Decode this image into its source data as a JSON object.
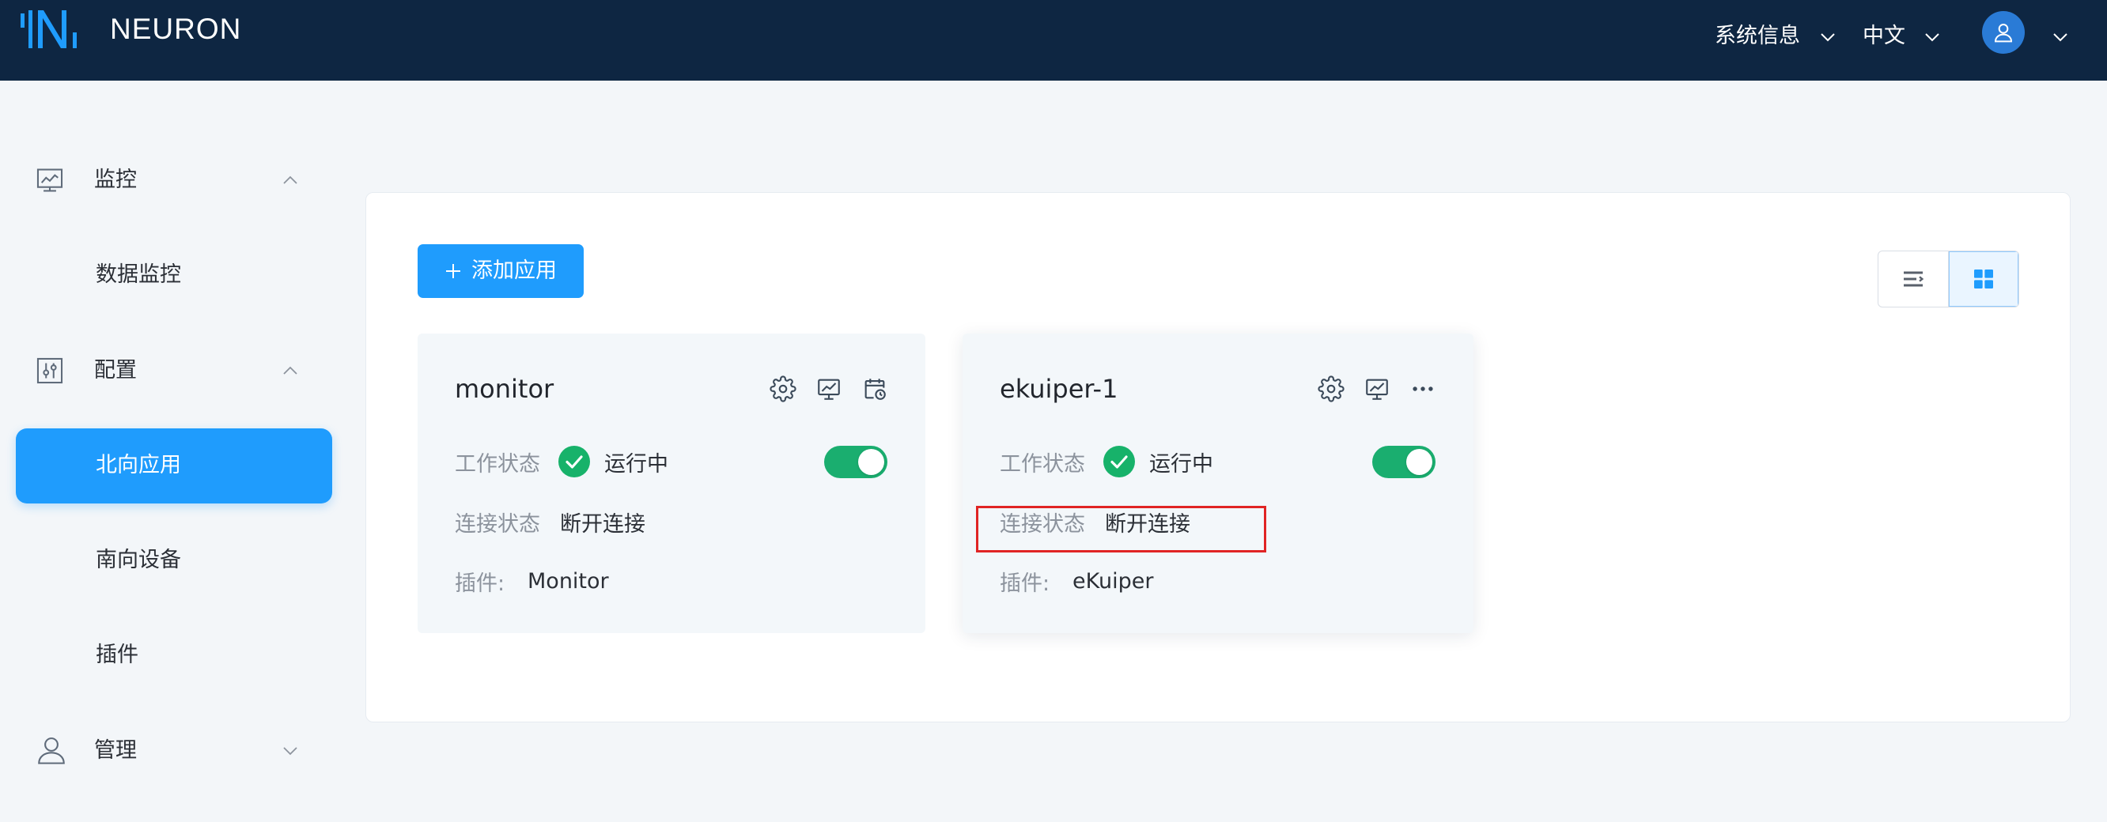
{
  "theme": {
    "header_bg": "#0e2642",
    "accent": "#1f9cfd",
    "success": "#17b26a",
    "page_bg": "#f3f6f9",
    "annotation": "#e02424"
  },
  "header": {
    "logo_icon": "neuron-logo-icon",
    "brand": "NEURON",
    "system_info": "系统信息",
    "language": "中文",
    "avatar_icon": "user-icon"
  },
  "sidebar": {
    "groups": [
      {
        "label": "监控",
        "icon": "monitor-chart-icon",
        "expanded": true,
        "items": [
          {
            "label": "数据监控",
            "active": false
          }
        ]
      },
      {
        "label": "配置",
        "icon": "sliders-icon",
        "expanded": true,
        "items": [
          {
            "label": "北向应用",
            "active": true
          },
          {
            "label": "南向设备",
            "active": false
          },
          {
            "label": "插件",
            "active": false
          }
        ]
      },
      {
        "label": "管理",
        "icon": "user-icon",
        "expanded": false,
        "items": []
      }
    ]
  },
  "toolbar": {
    "add_button": {
      "icon": "plus-icon",
      "label": "添加应用"
    },
    "view_modes": [
      {
        "icon": "list-view-icon",
        "active": false
      },
      {
        "icon": "grid-view-icon",
        "active": true
      }
    ]
  },
  "nodes": [
    {
      "name": "monitor",
      "actions": [
        "gear-icon",
        "monitor-chart-icon",
        "calendar-clock-icon"
      ],
      "work_status_label": "工作状态",
      "work_status": "运行中",
      "enabled": true,
      "connection_label": "连接状态",
      "connection_status": "断开连接",
      "connection_highlighted": false,
      "plugin_label": "插件:",
      "plugin": "Monitor"
    },
    {
      "name": "ekuiper-1",
      "actions": [
        "gear-icon",
        "monitor-chart-icon",
        "ellipsis-icon"
      ],
      "work_status_label": "工作状态",
      "work_status": "运行中",
      "enabled": true,
      "connection_label": "连接状态",
      "connection_status": "断开连接",
      "connection_highlighted": true,
      "plugin_label": "插件:",
      "plugin": "eKuiper"
    }
  ]
}
